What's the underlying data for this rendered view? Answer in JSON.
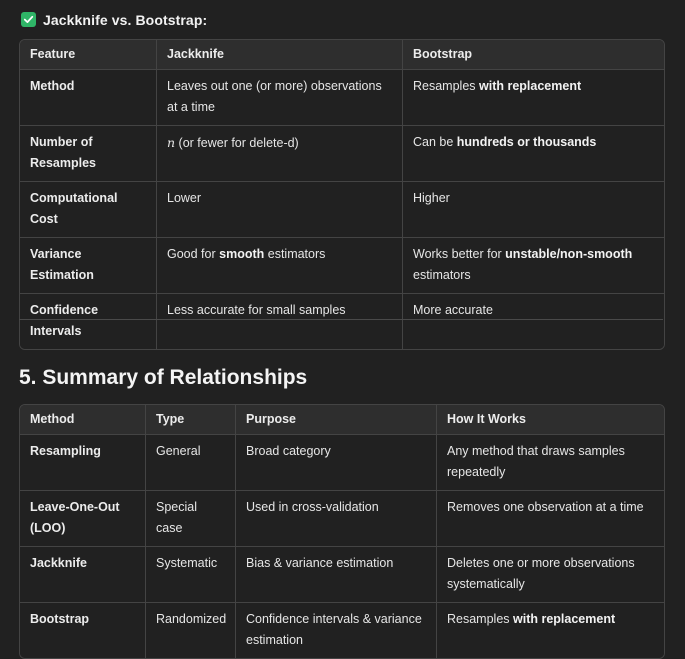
{
  "comparison": {
    "heading": "Jackknife vs. Bootstrap:",
    "headers": [
      "Feature",
      "Jackknife",
      "Bootstrap"
    ],
    "rows": [
      {
        "feature": "Method",
        "jackknife": [
          {
            "t": "Leaves out one (or more) observations at a time"
          }
        ],
        "bootstrap": [
          {
            "t": "Resamples "
          },
          {
            "t": "with replacement",
            "b": true
          }
        ]
      },
      {
        "feature": "Number of Resamples",
        "jackknife": [
          {
            "t": "n",
            "i": true
          },
          {
            "t": " (or fewer for delete-d)"
          }
        ],
        "bootstrap": [
          {
            "t": "Can be "
          },
          {
            "t": "hundreds or thousands",
            "b": true
          }
        ]
      },
      {
        "feature": "Computational Cost",
        "jackknife": [
          {
            "t": "Lower"
          }
        ],
        "bootstrap": [
          {
            "t": "Higher"
          }
        ]
      },
      {
        "feature": "Variance Estimation",
        "jackknife": [
          {
            "t": "Good for "
          },
          {
            "t": "smooth",
            "b": true
          },
          {
            "t": " estimators"
          }
        ],
        "bootstrap": [
          {
            "t": "Works better for "
          },
          {
            "t": "unstable/non-smooth",
            "b": true
          },
          {
            "t": " estimators"
          }
        ]
      },
      {
        "feature": "Confidence Intervals",
        "jackknife": [
          {
            "t": "Less accurate for small samples"
          }
        ],
        "bootstrap": [
          {
            "t": "More accurate"
          }
        ]
      }
    ]
  },
  "summary": {
    "title": "5. Summary of Relationships",
    "headers": [
      "Method",
      "Type",
      "Purpose",
      "How It Works"
    ],
    "rows": [
      {
        "method": "Resampling",
        "type": "General",
        "purpose": "Broad category",
        "how": [
          {
            "t": "Any method that draws samples repeatedly"
          }
        ]
      },
      {
        "method": "Leave-One-Out (LOO)",
        "type": "Special case",
        "purpose": "Used in cross-validation",
        "how": [
          {
            "t": "Removes one observation at a time"
          }
        ]
      },
      {
        "method": "Jackknife",
        "type": "Systematic",
        "purpose": "Bias & variance estimation",
        "how": [
          {
            "t": "Deletes one or more observations systematically"
          }
        ]
      },
      {
        "method": "Bootstrap",
        "type": "Randomized",
        "purpose": "Confidence intervals & variance estimation",
        "how": [
          {
            "t": "Resamples "
          },
          {
            "t": "with replacement",
            "b": true
          }
        ]
      }
    ]
  },
  "icons": {
    "heading_check": "check-box-icon"
  },
  "colors": {
    "background": "#212121",
    "check_green": "#2fb567",
    "border": "#444444",
    "header_bg": "#2e2e2e"
  }
}
